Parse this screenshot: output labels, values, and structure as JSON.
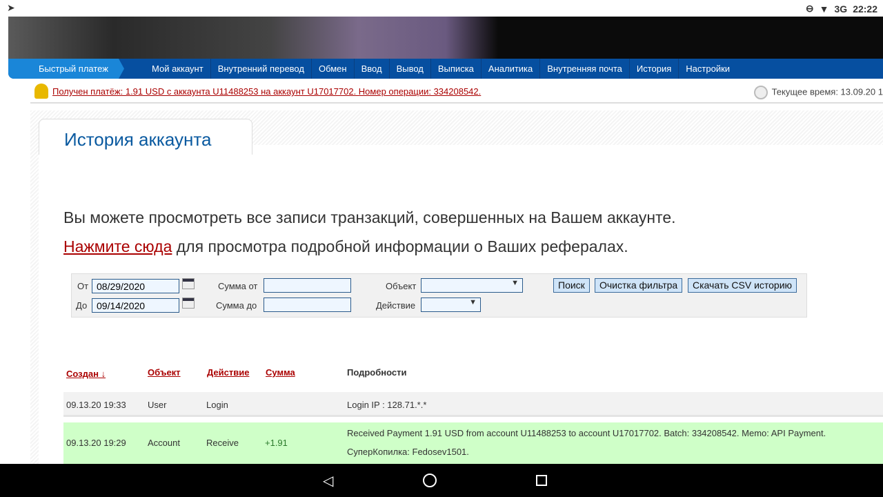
{
  "status": {
    "time": "22:22",
    "network": "3G"
  },
  "nav": {
    "quick": "Быстрый платеж",
    "items": [
      "Мой аккаунт",
      "Внутренний перевод",
      "Обмен",
      "Ввод",
      "Вывод",
      "Выписка",
      "Аналитика",
      "Внутренняя почта",
      "История",
      "Настройки"
    ]
  },
  "notice": {
    "message": "Получен платёж: 1.91 USD с аккаунта U11488253 на аккаунт U17017702. Номер операции: 334208542.",
    "time": "Текущее время: 13.09.20 1"
  },
  "page": {
    "title": "История аккаунта",
    "intro": "Вы можете просмотреть все записи транзакций, совершенных на Вашем аккаунте.",
    "link": "Нажмите сюда",
    "link_rest": " для просмотра подробной информации о Ваших рефералах."
  },
  "filter": {
    "from_label": "От",
    "from": "08/29/2020",
    "to_label": "До",
    "to": "09/14/2020",
    "sum_from_label": "Сумма от",
    "sum_to_label": "Сумма до",
    "object_label": "Объект",
    "action_label": "Действие",
    "search": "Поиск",
    "clear": "Очистка фильтра",
    "csv": "Скачать CSV историю"
  },
  "table": {
    "headers": [
      "Создан ↓",
      "Объект",
      "Действие",
      "Сумма",
      "Подробности"
    ],
    "rows": [
      {
        "created": "09.13.20 19:33",
        "object": "User",
        "action": "Login",
        "amount": "",
        "details": "Login IP : 128.71.*.*",
        "details2": ""
      },
      {
        "created": "09.13.20 19:29",
        "object": "Account",
        "action": "Receive",
        "amount": "+1.91",
        "details": "Received Payment 1.91 USD from account U11488253 to account U17017702. Batch: 334208542. Memo: API Payment.",
        "details2": "СуперКопилка: Fedosev1501."
      }
    ]
  }
}
